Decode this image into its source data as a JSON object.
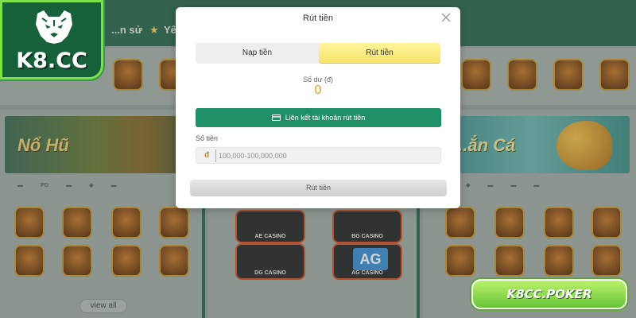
{
  "background": {
    "nav_tabs": [
      "...n sử",
      "Yê..."
    ],
    "banners": {
      "left": "Nổ Hũ",
      "right": "...ắn Cá"
    },
    "providers": [
      "PG"
    ],
    "casinos": [
      "AE CASINO",
      "BG CASINO",
      "DG CASINO",
      "AG CASINO"
    ],
    "casino_ag_label": "AG",
    "view_all": "view all"
  },
  "brand": {
    "logo_text": "K8.CC"
  },
  "modal": {
    "title": "Rút tiền",
    "tabs": {
      "deposit": "Nạp tiền",
      "withdraw": "Rút tiền",
      "active": "withdraw"
    },
    "balance": {
      "label": "Số dư (đ)",
      "value": "0"
    },
    "link_account_button": "Liên kết tài khoản rút tiền",
    "amount": {
      "label": "Số tiền",
      "placeholder": "100,000-100,000,000",
      "currency_symbol": "đ"
    },
    "submit_button": "Rút tiền"
  },
  "watermark": "K8CC.POKER",
  "colors": {
    "primary_green": "#1f8f66",
    "active_tab_yellow": "#f6e36a",
    "balance_orange": "#e09b1a",
    "brand_lime": "#7ee04a"
  }
}
